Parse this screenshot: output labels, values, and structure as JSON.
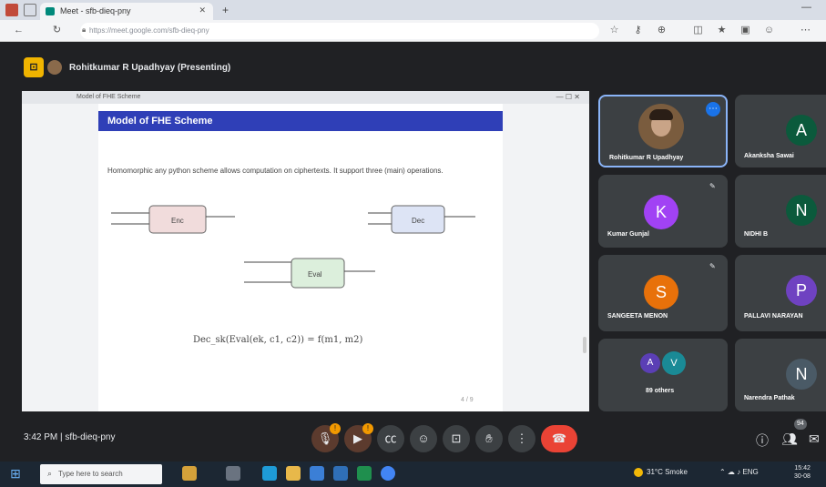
{
  "browser": {
    "tab_title": "Meet - sfb-dieq-pny",
    "new_tab": "+",
    "url": "https://meet.google.com/sfb-dieq-pny"
  },
  "meet": {
    "presenting_label": "Rohitkumar R Upadhyay (Presenting)",
    "meeting_time": "3:42 PM",
    "meeting_code": "sfb-dieq-pny"
  },
  "shared_screen": {
    "window_bar": "Model of FHE Scheme",
    "slide_title": "Model of FHE Scheme",
    "slide_text": "Homomorphic any python scheme allows computation on ciphertexts. It support three (main) operations.",
    "boxes": [
      "Enc",
      "Dec",
      "Eval"
    ],
    "formula": "Dec_sk(Eval(ek, c1, c2)) = f(m1, m2)",
    "page_label": "4 / 9"
  },
  "tiles": [
    {
      "name": "Rohitkumar R Upadhyay",
      "avatar_letter": "",
      "color": "#7a5c3e",
      "pinned": true
    },
    {
      "name": "Akanksha Sawai",
      "avatar_letter": "A",
      "color": "#0b5a3c"
    },
    {
      "name": "Kumar Gunjal",
      "avatar_letter": "K",
      "color": "#a142f4"
    },
    {
      "name": "NIDHI B",
      "avatar_letter": "N",
      "color": "#0b5a3c"
    },
    {
      "name": "SANGEETA MENON",
      "avatar_letter": "S",
      "color": "#e8710a"
    },
    {
      "name": "PALLAVI NARAYAN",
      "avatar_letter": "P",
      "color": "#6f42c1"
    },
    {
      "name": "89 others",
      "avatar_letter": "A",
      "avatar_letter2": "V",
      "color": "#5b3fb5",
      "color2": "#1a8a96"
    },
    {
      "name": "Narendra Pathak",
      "avatar_letter": "N",
      "color": "#4a5a66"
    }
  ],
  "controls": {
    "mic_badge": "!",
    "cam_badge": "!",
    "participants_count": "94"
  },
  "taskbar": {
    "search_placeholder": "Type here to search",
    "weather": "31°C Smoke",
    "time": "15:42",
    "date": "30-08"
  }
}
